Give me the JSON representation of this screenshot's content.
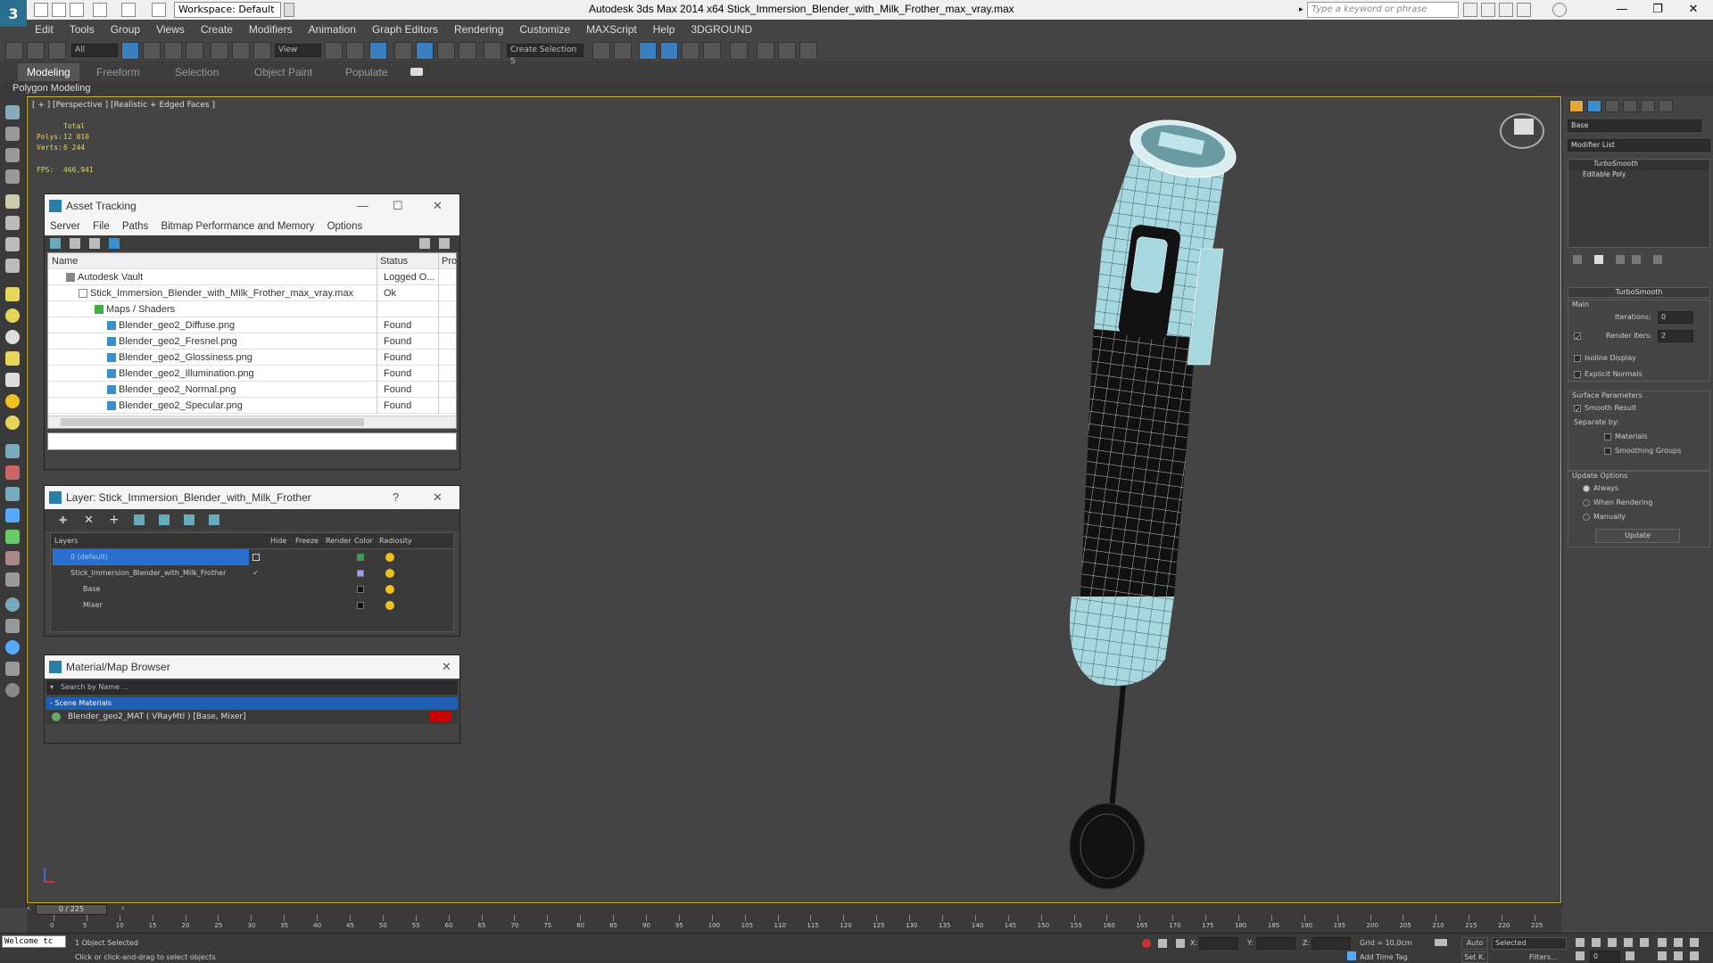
{
  "app": {
    "workspace": "Workspace: Default",
    "window_title": "Autodesk 3ds Max  2014 x64      Stick_Immersion_Blender_with_Milk_Frother_max_vray.max",
    "search_placeholder": "Type a keyword or phrase"
  },
  "menu": [
    "Edit",
    "Tools",
    "Group",
    "Views",
    "Create",
    "Modifiers",
    "Animation",
    "Graph Editors",
    "Rendering",
    "Customize",
    "MAXScript",
    "Help",
    "3DGROUND"
  ],
  "toolbar": {
    "selection_filter": "All",
    "ref_coord": "View",
    "named_selection": "Create Selection S"
  },
  "ribbon": {
    "tabs": [
      "Modeling",
      "Freeform",
      "Selection",
      "Object Paint",
      "Populate"
    ],
    "active_tab": "Modeling",
    "sub": "Polygon Modeling"
  },
  "viewport": {
    "label": "[ + ] [Perspective ] [Realistic + Edged Faces ]",
    "stats": {
      "total_label": "Total",
      "polys_label": "Polys:",
      "polys": "12 010",
      "verts_label": "Verts:",
      "verts": "6 244",
      "fps_label": "FPS:",
      "fps": "466,941"
    }
  },
  "asset_tracking": {
    "title": "Asset Tracking",
    "menu": [
      "Server",
      "File",
      "Paths",
      "Bitmap Performance and Memory",
      "Options"
    ],
    "columns": [
      "Name",
      "Status",
      "Pro"
    ],
    "rows": [
      {
        "name": "Autodesk Vault",
        "status": "Logged O..."
      },
      {
        "name": "Stick_Immersion_Blender_with_Milk_Frother_max_vray.max",
        "status": "Ok"
      },
      {
        "name": "Maps / Shaders",
        "status": ""
      },
      {
        "name": "Blender_geo2_Diffuse.png",
        "status": "Found"
      },
      {
        "name": "Blender_geo2_Fresnel.png",
        "status": "Found"
      },
      {
        "name": "Blender_geo2_Glossiness.png",
        "status": "Found"
      },
      {
        "name": "Blender_geo2_Illumination.png",
        "status": "Found"
      },
      {
        "name": "Blender_geo2_Normal.png",
        "status": "Found"
      },
      {
        "name": "Blender_geo2_Specular.png",
        "status": "Found"
      }
    ]
  },
  "layer": {
    "title": "Layer: Stick_Immersion_Blender_with_Milk_Frother",
    "help": "?",
    "columns": [
      "Layers",
      "Hide",
      "Freeze",
      "Render",
      "Color",
      "Radiosity"
    ],
    "rows": [
      {
        "name": "0 (default)",
        "color": "#22aa44"
      },
      {
        "name": "Stick_Immersion_Blender_with_Milk_Frother",
        "color": "#9999ff"
      },
      {
        "name": "Base",
        "color": "#111111"
      },
      {
        "name": "Mixer",
        "color": "#111111"
      }
    ]
  },
  "material_browser": {
    "title": "Material/Map Browser",
    "search_placeholder": "Search by Name ...",
    "group": "- Scene Materials",
    "item": "Blender_geo2_MAT ( VRayMtl ) [Base, Mixer]"
  },
  "command_panel": {
    "object_name": "Base",
    "modifier_list": "Modifier List",
    "stack": [
      "TurboSmooth",
      "Editable Poly"
    ],
    "turbosmooth": {
      "title": "TurboSmooth",
      "main": "Main",
      "iterations_label": "Iterations:",
      "iterations": "0",
      "render_iters_label": "Render Iters:",
      "render_iters": "2",
      "isoline": "Isoline Display",
      "explicit": "Explicit Normals",
      "surface": "Surface Parameters",
      "smooth_result": "Smooth Result",
      "separate_by": "Separate by:",
      "materials": "Materials",
      "smoothing_groups": "Smoothing Groups",
      "update_options": "Update Options",
      "always": "Always",
      "when_rendering": "When Rendering",
      "manually": "Manually",
      "update": "Update"
    }
  },
  "timeline": {
    "frame": "0 / 225",
    "ticks": [
      "0",
      "5",
      "10",
      "15",
      "20",
      "25",
      "30",
      "35",
      "40",
      "45",
      "50",
      "55",
      "60",
      "65",
      "70",
      "75",
      "80",
      "85",
      "90",
      "95",
      "100",
      "105",
      "110",
      "115",
      "120",
      "125",
      "130",
      "135",
      "140",
      "145",
      "150",
      "155",
      "160",
      "165",
      "170",
      "175",
      "180",
      "185",
      "190",
      "195",
      "200",
      "205",
      "210",
      "215",
      "220",
      "225"
    ]
  },
  "status": {
    "maxscript": "Welcome tc",
    "selected": "1 Object Selected",
    "prompt": "Click or click-and-drag to select objects",
    "x_label": "X:",
    "y_label": "Y:",
    "z_label": "Z:",
    "grid": "Grid = 10,0cm",
    "add_time_tag": "Add Time Tag",
    "auto": "Auto",
    "selected_dropdown": "Selected",
    "set_key": "Set K.",
    "filters": "Filters...",
    "frame_field": "0"
  }
}
